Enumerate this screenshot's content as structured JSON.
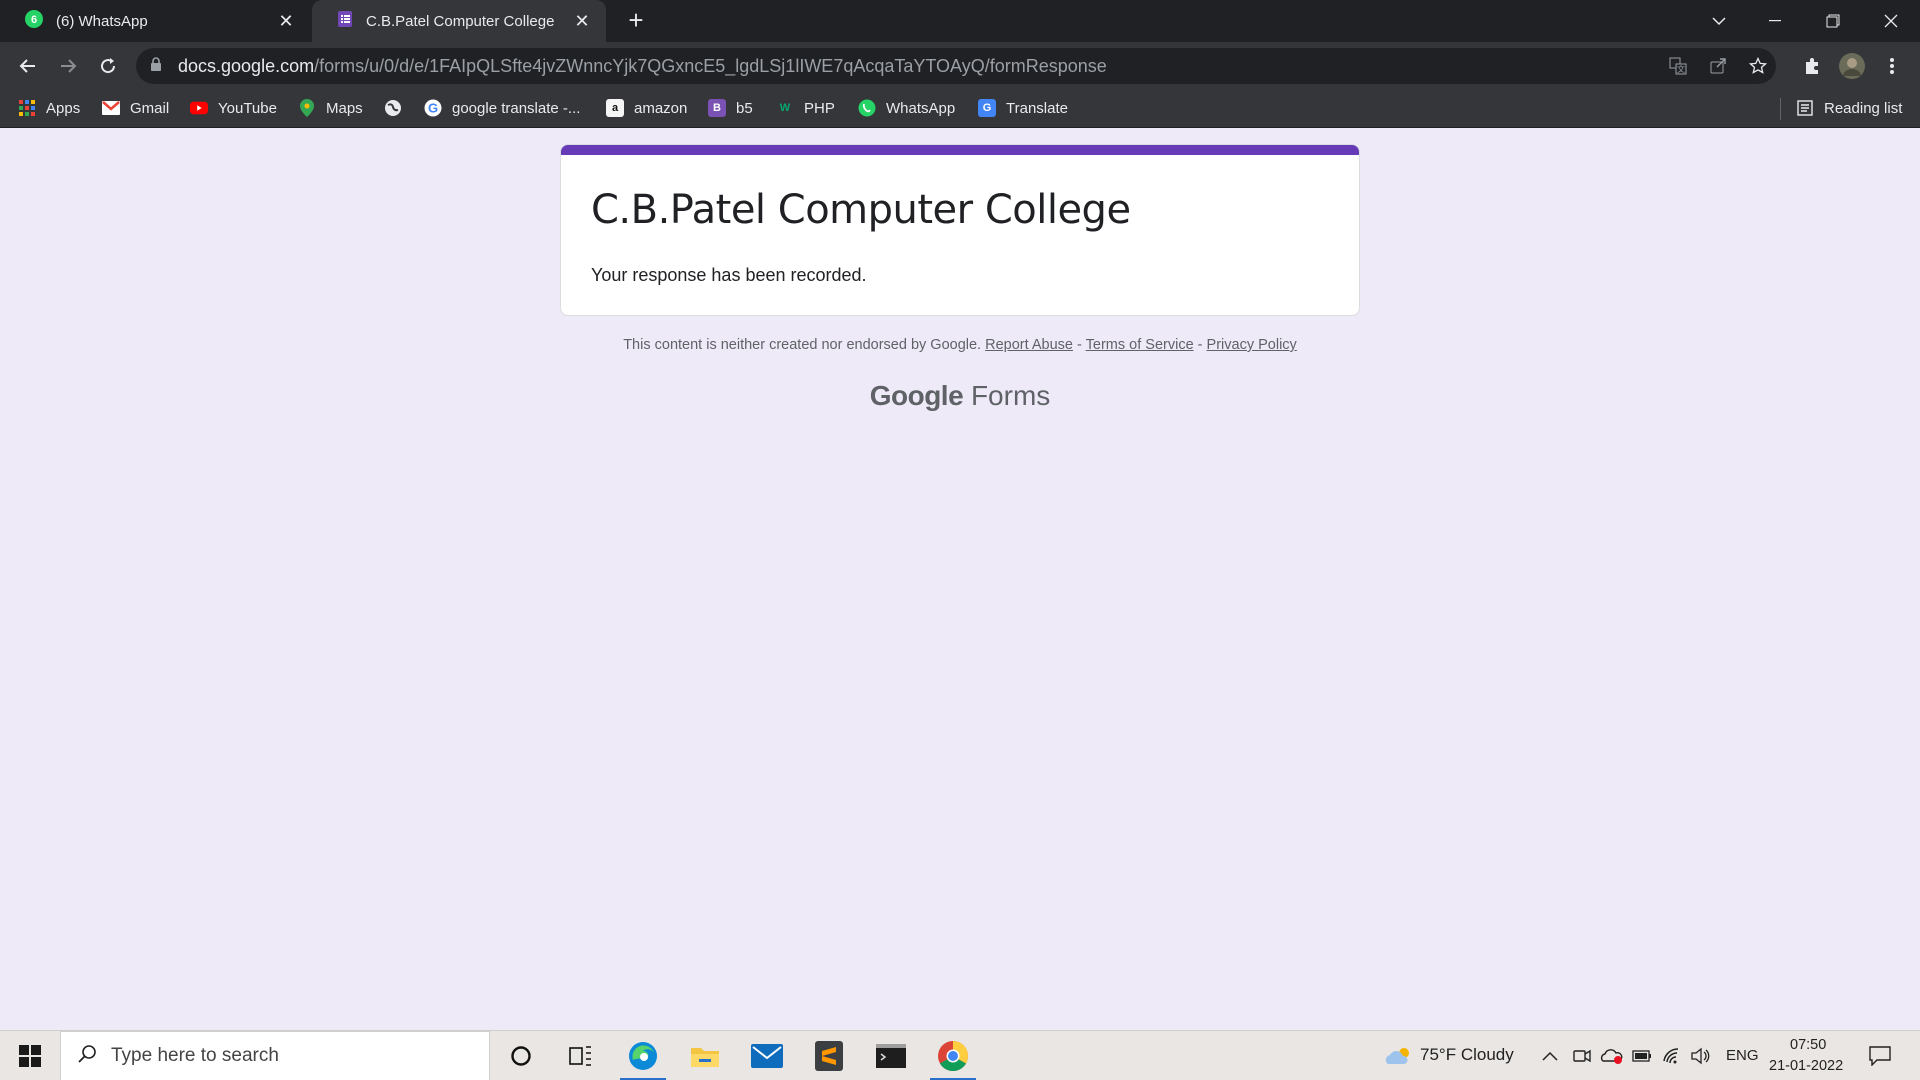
{
  "browser": {
    "tabs": [
      {
        "label": "(6) WhatsApp",
        "icon": "whatsapp-icon",
        "badge": "6"
      },
      {
        "label": "C.B.Patel Computer College",
        "icon": "google-forms-icon"
      }
    ],
    "address_host": "docs.google.com",
    "address_path": "/forms/u/0/d/e/1FAIpQLSfte4jvZWnncYjk7QGxncE5_lgdLSj1lIWE7qAcqaTaYTOAyQ/formResponse",
    "bookmarks": [
      {
        "label": "Apps",
        "icon": "apps-grid-icon",
        "color": "#4285f4"
      },
      {
        "label": "Gmail",
        "icon": "gmail-icon",
        "color": "#ea4335"
      },
      {
        "label": "YouTube",
        "icon": "youtube-icon",
        "color": "#ff0000"
      },
      {
        "label": "Maps",
        "icon": "maps-icon",
        "color": "#34a853"
      },
      {
        "label": "",
        "icon": "globe-icon",
        "color": "#e8eaed"
      },
      {
        "label": "google translate -...",
        "icon": "google-icon",
        "color": "#4285f4"
      },
      {
        "label": "amazon",
        "icon": "amazon-icon",
        "color": "#f5f5f5"
      },
      {
        "label": "b5",
        "icon": "bootstrap-icon",
        "color": "#7952b3"
      },
      {
        "label": "PHP",
        "icon": "w3schools-icon",
        "color": "#04aa6d"
      },
      {
        "label": "WhatsApp",
        "icon": "whatsapp-icon",
        "color": "#25d366"
      },
      {
        "label": "Translate",
        "icon": "translate-icon",
        "color": "#4285f4"
      }
    ],
    "reading_list": "Reading list"
  },
  "page": {
    "form_title": "C.B.Patel Computer College",
    "message": "Your response has been recorded.",
    "footer_prefix": "This content is neither created nor endorsed by Google.",
    "report_abuse": "Report Abuse",
    "sep": "-",
    "terms": "Terms of Service",
    "privacy": "Privacy Policy",
    "logo_google": "Google",
    "logo_forms": "Forms",
    "accent_color": "#673ab7"
  },
  "taskbar": {
    "search_placeholder": "Type here to search",
    "weather": "75°F  Cloudy",
    "language": "ENG",
    "time": "07:50",
    "date": "21-01-2022"
  }
}
